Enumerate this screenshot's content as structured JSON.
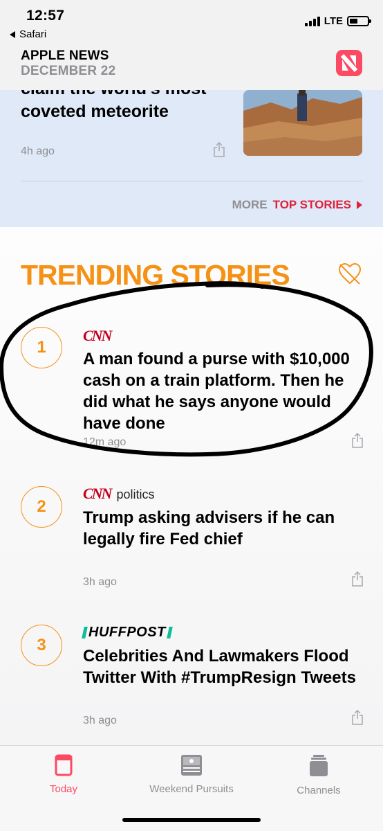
{
  "status_bar": {
    "time": "12:57",
    "back_app": "Safari",
    "network": "LTE",
    "battery_level": 0.45
  },
  "header": {
    "title": "APPLE NEWS",
    "date": "DECEMBER 22",
    "logo_icon": "apple-news-icon",
    "logo_color": "#fb4a64"
  },
  "top_story": {
    "headline": "claim the world's most coveted meteorite",
    "time": "4h ago",
    "share_icon": "share-icon",
    "more_label": "MORE",
    "more_link": "TOP STORIES"
  },
  "trending": {
    "title": "TRENDING STORIES",
    "title_color": "#f59216",
    "heart_icon": "heart-broken-icon",
    "stories": [
      {
        "number": "1",
        "source": "CNN",
        "source_suffix": "",
        "headline": "A man found a purse with $10,000 cash on a train platform. Then he did what he says anyone would have done",
        "time": "12m ago"
      },
      {
        "number": "2",
        "source": "CNN",
        "source_suffix": "politics",
        "headline": "Trump asking advisers if he can legally fire Fed chief",
        "time": "3h ago"
      },
      {
        "number": "3",
        "source": "HUFFPOST",
        "source_suffix": "",
        "headline": "Celebrities And Lawmakers Flood Twitter With #TrumpResign Tweets",
        "time": "3h ago"
      }
    ]
  },
  "tabbar": {
    "tabs": [
      {
        "label": "Today",
        "icon": "today-icon",
        "active": true
      },
      {
        "label": "Weekend Pursuits",
        "icon": "weekend-pursuits-icon",
        "active": false
      },
      {
        "label": "Channels",
        "icon": "channels-icon",
        "active": false
      }
    ]
  }
}
